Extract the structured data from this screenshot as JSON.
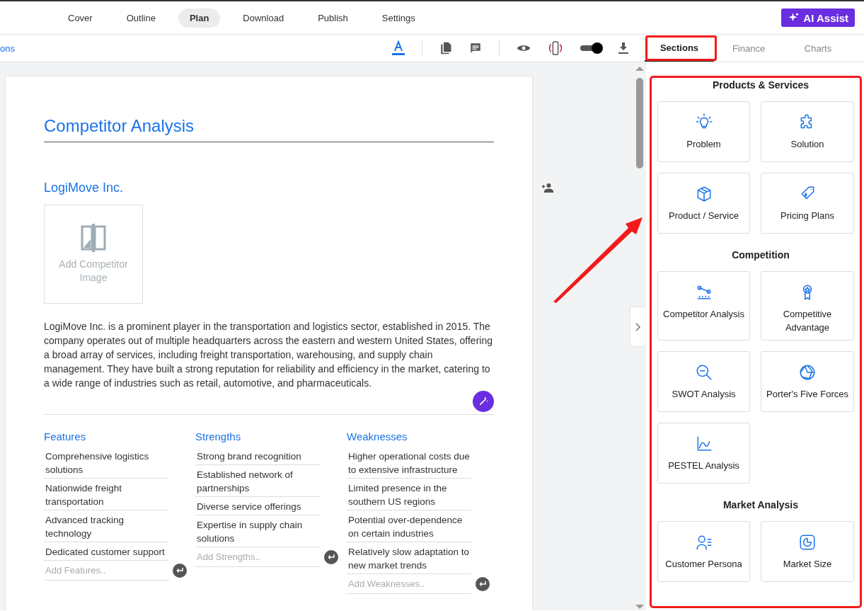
{
  "nav": {
    "tabs": [
      {
        "label": "Cover",
        "selected": false
      },
      {
        "label": "Outline",
        "selected": false
      },
      {
        "label": "Plan",
        "selected": true
      },
      {
        "label": "Download",
        "selected": false
      },
      {
        "label": "Publish",
        "selected": false
      },
      {
        "label": "Settings",
        "selected": false
      }
    ],
    "ai_button": "AI Assist"
  },
  "toolbar": {
    "link": "ons",
    "preview_toggle": {
      "on": true
    }
  },
  "panel_tabs": [
    {
      "label": "Sections",
      "selected": true
    },
    {
      "label": "Finance",
      "selected": false
    },
    {
      "label": "Charts",
      "selected": false
    }
  ],
  "sections": [
    {
      "title": "Products & Services",
      "items": [
        "Problem",
        "Solution",
        "Product / Service",
        "Pricing Plans"
      ]
    },
    {
      "title": "Competition",
      "items": [
        "Competitor Analysis",
        "Competitive Advantage",
        "SWOT Analysis",
        "Porter's Five Forces",
        "PESTEL Analysis"
      ]
    },
    {
      "title": "Market Analysis",
      "items": [
        "Customer Persona",
        "Market Size"
      ]
    }
  ],
  "document": {
    "title": "Competitor Analysis",
    "competitor": "LogiMove Inc.",
    "image_placeholder": "Add Competitor Image",
    "description": "LogiMove Inc. is a prominent player in the transportation and logistics sector, established in 2015. The company operates out of multiple headquarters across the eastern and western United States, offering a broad array of services, including freight transportation, warehousing, and supply chain management. They have built a strong reputation for reliability and efficiency in the market, catering to a wide range of industries such as retail, automotive, and pharmaceuticals.",
    "columns": [
      {
        "heading": "Features",
        "items": [
          "Comprehensive logistics solutions",
          "Nationwide freight transportation",
          "Advanced tracking technology",
          "Dedicated customer support"
        ],
        "placeholder": "Add Features.."
      },
      {
        "heading": "Strengths",
        "items": [
          "Strong brand recognition",
          "Established network of partnerships",
          "Diverse service offerings",
          "Expertise in supply chain solutions"
        ],
        "placeholder": "Add Strengths.."
      },
      {
        "heading": "Weaknesses",
        "items": [
          "Higher operational costs due to extensive infrastructure",
          "Limited presence in the southern US regions",
          "Potential over-dependence on certain industries",
          "Relatively slow adaptation to new market trends"
        ],
        "placeholder": "Add Weaknesses.."
      }
    ]
  }
}
